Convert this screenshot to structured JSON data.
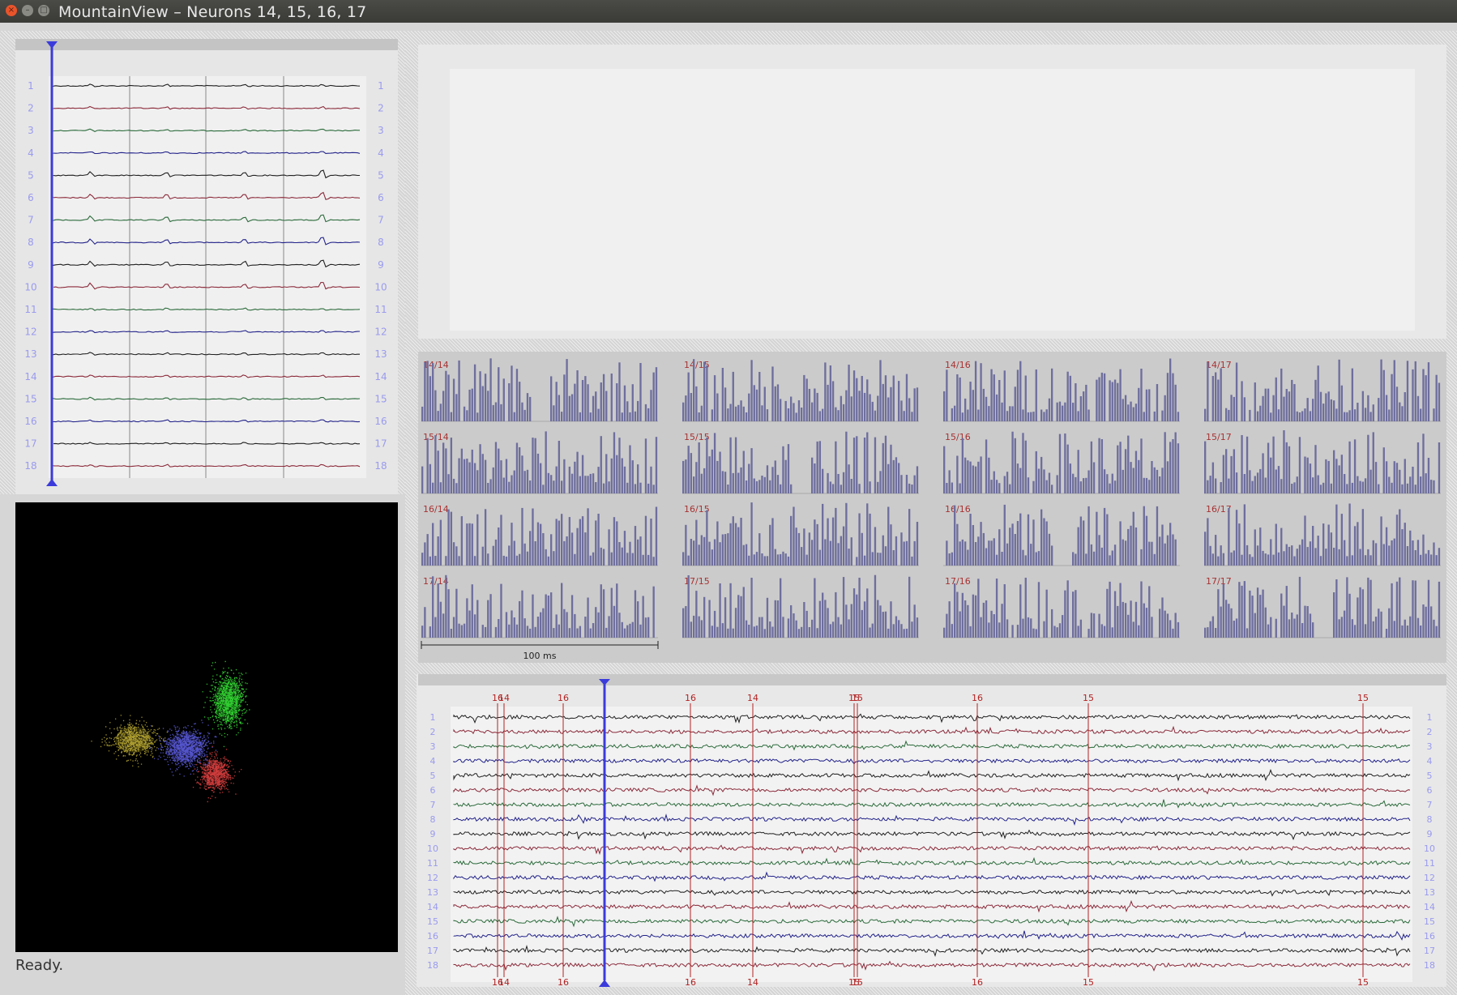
{
  "window": {
    "title": "MountainView – Neurons 14, 15, 16, 17",
    "close_glyph": "×",
    "min_glyph": "–",
    "max_glyph": "□"
  },
  "status": {
    "text": "Ready."
  },
  "templates": {
    "channels": [
      "1",
      "2",
      "3",
      "4",
      "5",
      "6",
      "7",
      "8",
      "9",
      "10",
      "11",
      "12",
      "13",
      "14",
      "15",
      "16",
      "17",
      "18"
    ]
  },
  "correlograms": {
    "cells": [
      [
        "14/14",
        "14/15",
        "14/16",
        "14/17"
      ],
      [
        "15/14",
        "15/15",
        "15/16",
        "15/17"
      ],
      [
        "16/14",
        "16/15",
        "16/16",
        "16/17"
      ],
      [
        "17/14",
        "17/15",
        "17/16",
        "17/17"
      ]
    ],
    "scale_label": "100 ms"
  },
  "timeseries": {
    "channels": [
      "1",
      "2",
      "3",
      "4",
      "5",
      "6",
      "7",
      "8",
      "9",
      "10",
      "11",
      "12",
      "13",
      "14",
      "15",
      "16",
      "17",
      "18"
    ],
    "event_labels": [
      "16",
      "14",
      "16",
      "16",
      "14",
      "15",
      "15",
      "16",
      "15",
      "15"
    ]
  },
  "colors": {
    "accent": "#3b3bdc",
    "bar": "#6e6e9e",
    "event": "#b22222",
    "channel_label": "#9a9aef",
    "trace_cycle": [
      "#202020",
      "#8b2a3a",
      "#2a6a3a",
      "#22228a"
    ]
  },
  "clusters": [
    {
      "name": "green",
      "color": "#3cff3c"
    },
    {
      "name": "yellow",
      "color": "#d4c23a"
    },
    {
      "name": "blue",
      "color": "#6a6aff"
    },
    {
      "name": "red",
      "color": "#ff4a4a"
    }
  ]
}
